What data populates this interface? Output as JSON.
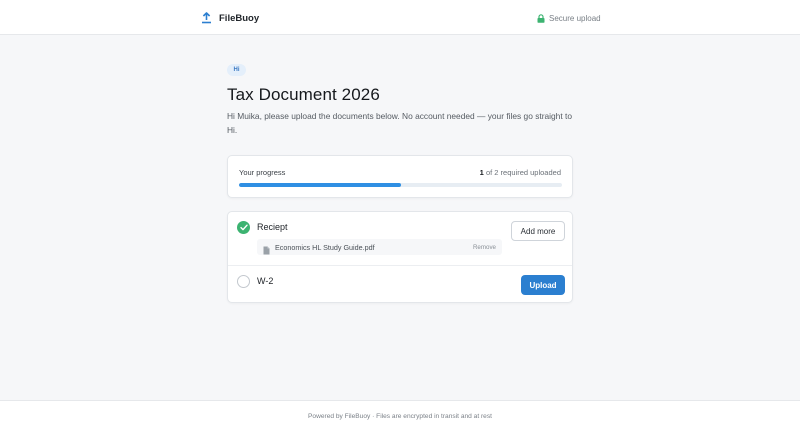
{
  "header": {
    "brand_name": "FileBuoy",
    "brand_icon": "upload-icon",
    "secure_label": "Secure upload",
    "secure_icon": "lock-icon"
  },
  "request": {
    "badge": "Hi",
    "title": "Tax Document 2026",
    "intro": "Hi Muika, please upload the documents below. No account needed — your files go straight to Hi."
  },
  "progress": {
    "label": "Your progress",
    "uploaded": "1",
    "suffix": "of 2 required uploaded",
    "fraction": 0.5
  },
  "items": [
    {
      "name": "Reciept",
      "status": "complete",
      "files": [
        {
          "name": "Economics HL Study Guide.pdf",
          "remove_label": "Remove",
          "icon": "file-icon"
        }
      ],
      "action_label": "Add more"
    },
    {
      "name": "W-2",
      "status": "pending",
      "action_label": "Upload"
    }
  ],
  "footer": {
    "text": "Powered by FileBuoy · Files are encrypted in transit and at rest"
  },
  "colors": {
    "accent": "#2b7fd0",
    "progress": "#2f8fe3",
    "success": "#3cb371",
    "background": "#f6f7f9"
  }
}
